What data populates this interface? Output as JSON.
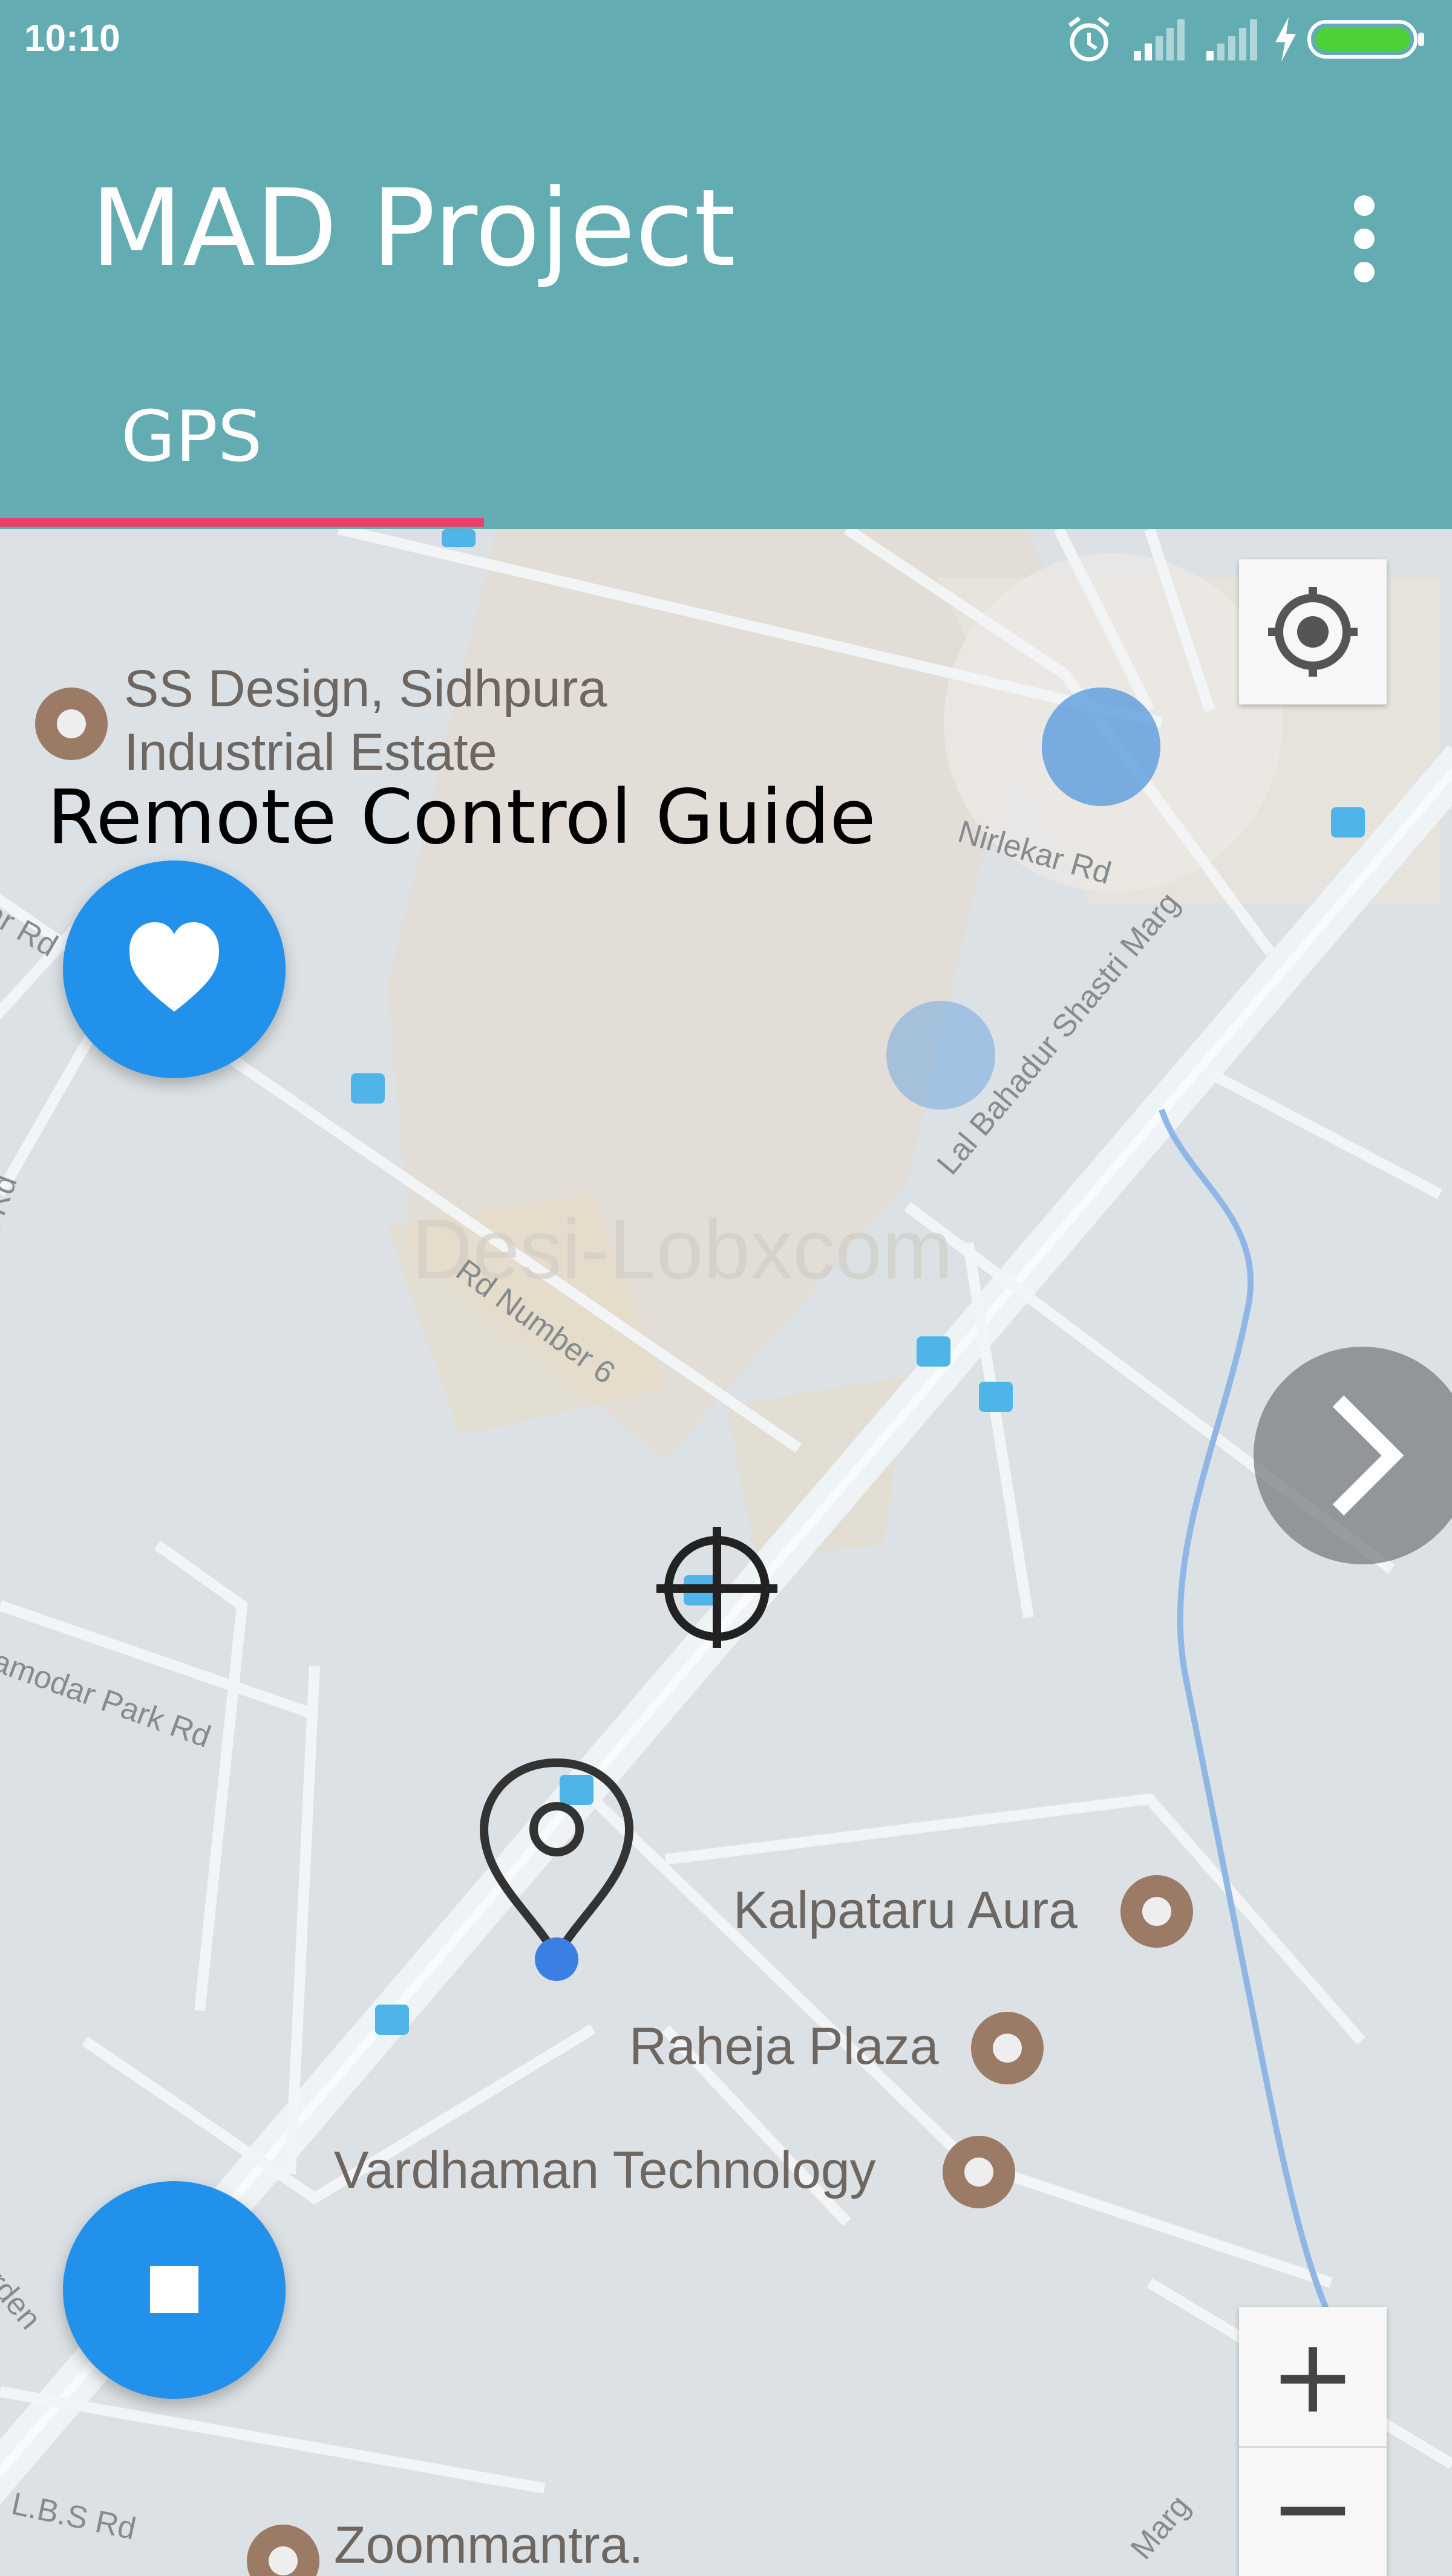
{
  "status_bar": {
    "time": "10:10",
    "icons": [
      "alarm-icon",
      "signal-icon",
      "signal-icon",
      "charging-icon",
      "battery-icon"
    ],
    "battery_color": "#4cd137"
  },
  "app_bar": {
    "title": "MAD Project",
    "background": "#62acb2",
    "menu_icon": "more-vert-icon"
  },
  "tabs": [
    {
      "label": "GPS",
      "selected": true,
      "indicator_color": "#ec3f6c"
    }
  ],
  "map": {
    "overlay_title": "Remote Control Guide",
    "watermark": "Desi-Lobxcom",
    "places": [
      {
        "name": "SS Design, Sidhpura",
        "name_line2": "Industrial Estate"
      },
      {
        "name": "Kalpataru Aura"
      },
      {
        "name": "Raheja Plaza"
      },
      {
        "name": "Vardhaman Technology"
      },
      {
        "name": "Zoommantra."
      }
    ],
    "roads": [
      "Nirlekar Rd",
      "Lal Bahadur Shastri Marg",
      "Rd Number 6",
      "amodar Park Rd",
      "L.B.S Rd",
      "ar Rd",
      "t Rd",
      "rden",
      "Marg"
    ],
    "controls": {
      "my_location_icon": "my-location-icon",
      "zoom_in": "+",
      "zoom_out": "−"
    }
  },
  "fabs": {
    "favorite_icon": "heart-icon",
    "stop_icon": "stop-icon",
    "color": "#2291ec"
  },
  "navigation": {
    "next_icon": "chevron-right-icon"
  }
}
